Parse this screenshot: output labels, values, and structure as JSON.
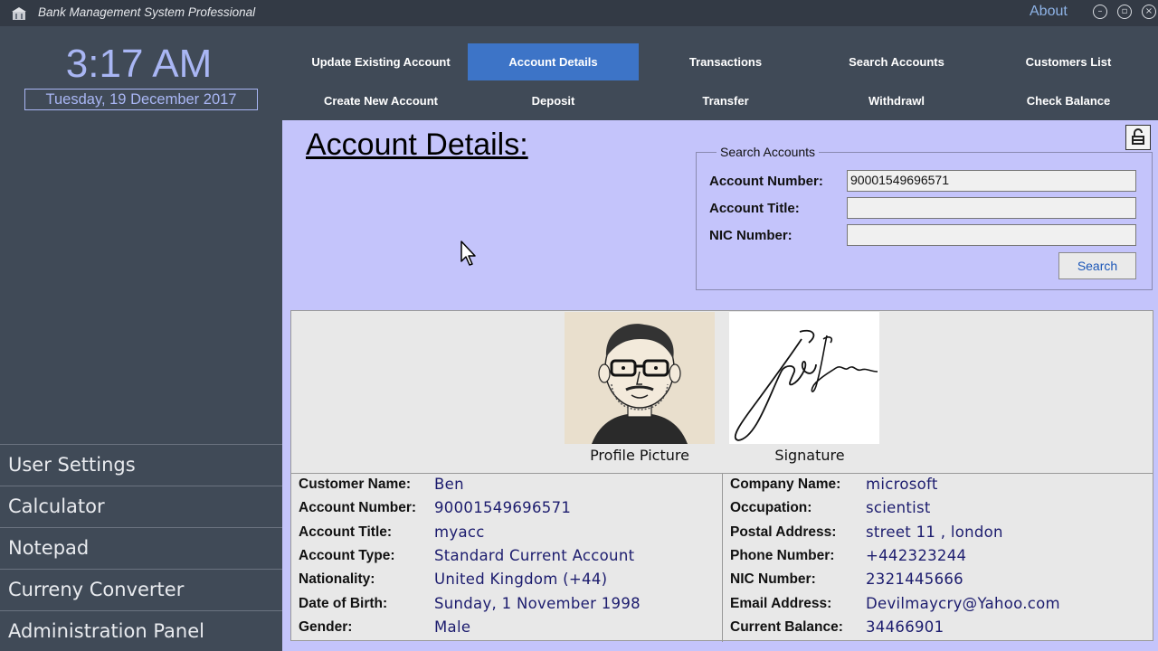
{
  "window": {
    "title": "Bank Management System Professional",
    "about_label": "About",
    "icons": [
      "minimize-icon",
      "maximize-icon",
      "close-icon"
    ]
  },
  "sidebar": {
    "time": "3:17 AM",
    "date": "Tuesday, 19 December 2017",
    "items": [
      {
        "label": "User Settings"
      },
      {
        "label": "Calculator"
      },
      {
        "label": "Notepad"
      },
      {
        "label": "Curreny Converter"
      },
      {
        "label": "Administration Panel"
      }
    ]
  },
  "nav": {
    "row1": [
      {
        "label": "Update Existing Account"
      },
      {
        "label": "Account Details",
        "active": true
      },
      {
        "label": "Transactions"
      },
      {
        "label": "Search Accounts"
      },
      {
        "label": "Customers List"
      }
    ],
    "row2": [
      {
        "label": "Create New Account"
      },
      {
        "label": "Deposit"
      },
      {
        "label": "Transfer"
      },
      {
        "label": "Withdrawl"
      },
      {
        "label": "Check Balance"
      }
    ]
  },
  "page": {
    "heading": "Account Details:"
  },
  "search": {
    "legend": "Search Accounts",
    "account_number_label": "Account Number:",
    "account_number_value": "90001549696571",
    "account_title_label": "Account Title:",
    "account_title_value": "",
    "nic_label": "NIC Number:",
    "nic_value": "",
    "button_label": "Search"
  },
  "images": {
    "profile_caption": "Profile Picture",
    "signature_caption": "Signature"
  },
  "details": {
    "left": [
      {
        "label": "Customer Name:",
        "value": "Ben"
      },
      {
        "label": "Account Number:",
        "value": "90001549696571"
      },
      {
        "label": "Account Title:",
        "value": "myacc"
      },
      {
        "label": "Account Type:",
        "value": "Standard Current Account"
      },
      {
        "label": "Nationality:",
        "value": "United Kingdom (+44)"
      },
      {
        "label": "Date of Birth:",
        "value": "Sunday, 1 November 1998"
      },
      {
        "label": "Gender:",
        "value": "Male"
      }
    ],
    "right": [
      {
        "label": "Company Name:",
        "value": "microsoft"
      },
      {
        "label": "Occupation:",
        "value": "scientist"
      },
      {
        "label": "Postal Address:",
        "value": "street 11 , london"
      },
      {
        "label": "Phone Number:",
        "value": "+442323244"
      },
      {
        "label": "NIC Number:",
        "value": "2321445666"
      },
      {
        "label": "Email Address:",
        "value": "Devilmaycry@Yahoo.com"
      },
      {
        "label": "Current Balance:",
        "value": "34466901"
      }
    ]
  },
  "colors": {
    "sidebar_bg": "#404a57",
    "content_bg": "#c4c4fb",
    "active_tab": "#3d74c7",
    "clock_text": "#a9b6f4",
    "value_text": "#1c1c6e"
  }
}
